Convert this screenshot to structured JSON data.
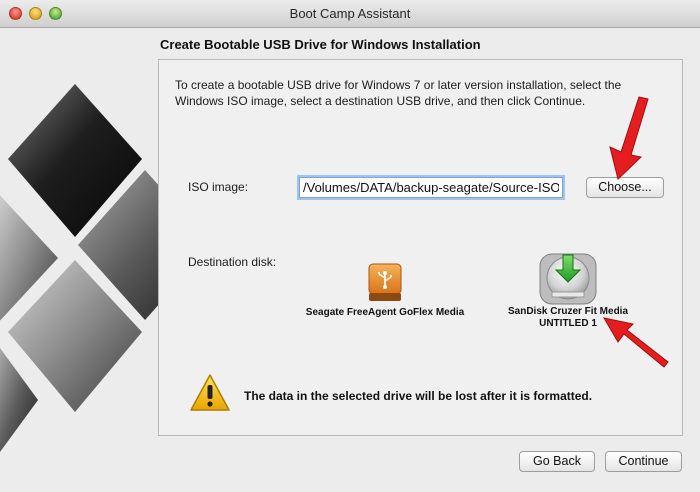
{
  "window": {
    "title": "Boot Camp Assistant"
  },
  "heading": "Create Bootable USB Drive for Windows Installation",
  "intro": "To create a bootable USB drive for Windows 7 or later version installation, select the Windows ISO image, select a destination USB drive, and then click Continue.",
  "iso": {
    "label": "ISO image:",
    "value": "/Volumes/DATA/backup-seagate/Source-ISO",
    "choose_label": "Choose..."
  },
  "destination": {
    "label": "Destination disk:",
    "disks": [
      {
        "name": "Seagate FreeAgent GoFlex Media",
        "volume": "",
        "icon": "usb-drive-icon",
        "color": "#e8862a"
      },
      {
        "name": "SanDisk Cruzer Fit Media",
        "volume": "UNTITLED 1",
        "icon": "disk-download-icon",
        "color": "#3cba2e",
        "selected": true
      }
    ]
  },
  "warning": {
    "icon": "warning-triangle-icon",
    "text": "The data in the selected drive will be lost after it is formatted."
  },
  "buttons": {
    "back": "Go Back",
    "continue": "Continue"
  },
  "annotations": {
    "arrow_color": "#e41e1e"
  }
}
